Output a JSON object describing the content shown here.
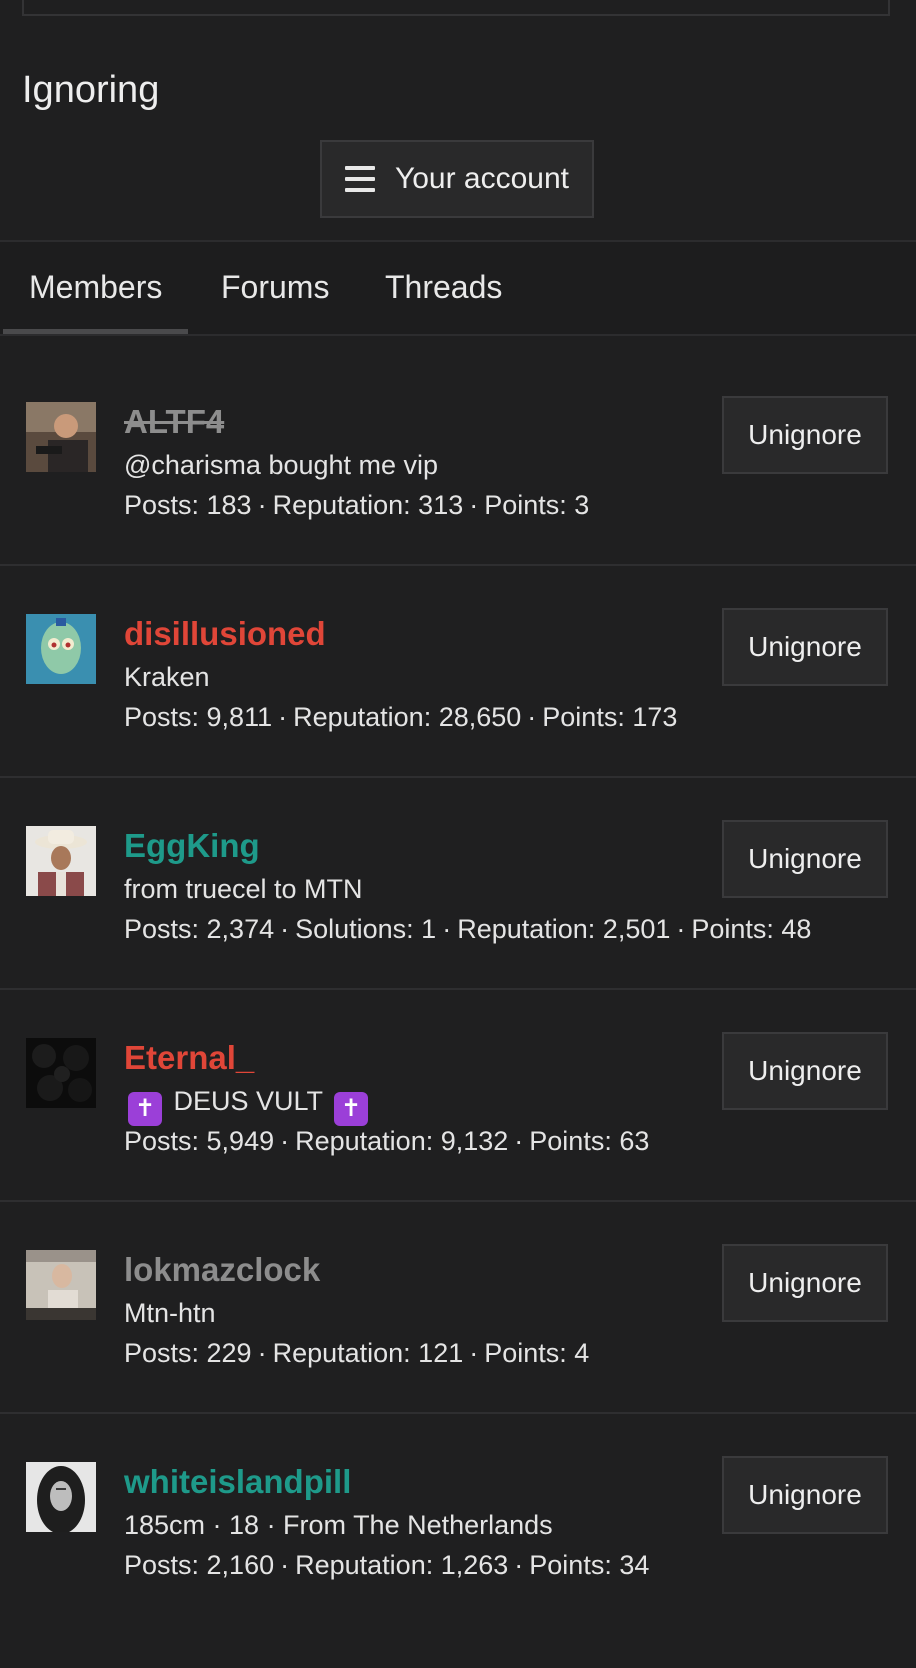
{
  "page": {
    "title": "Ignoring"
  },
  "account_menu": {
    "label": "Your account",
    "icon": "hamburger-menu-icon"
  },
  "tabs": [
    {
      "label": "Members",
      "active": true
    },
    {
      "label": "Forums",
      "active": false
    },
    {
      "label": "Threads",
      "active": false
    }
  ],
  "colors": {
    "background": "#1f1f20",
    "button_bg": "#29292a",
    "name_red": "#e04638",
    "name_teal": "#1e9a8a",
    "name_gray": "#8d8d8d",
    "cross_purple": "#9b3fd8"
  },
  "unignore_label": "Unignore",
  "stat_separator": "·",
  "members": [
    {
      "name": "ALTF4",
      "name_color": "#8d8d8d",
      "name_style": "strikethrough",
      "title": "@charisma bought me vip",
      "stats": [
        "Posts: 183",
        "Reputation: 313",
        "Points: 3"
      ]
    },
    {
      "name": "disillusioned",
      "name_color": "#e04638",
      "title": "Kraken",
      "stats": [
        "Posts: 9,811",
        "Reputation: 28,650",
        "Points: 173"
      ]
    },
    {
      "name": "EggKing",
      "name_color": "#1e9a8a",
      "title": "from truecel to MTN",
      "stats": [
        "Posts: 2,374",
        "Solutions: 1",
        "Reputation: 2,501",
        "Points: 48"
      ]
    },
    {
      "name": "Eternal_",
      "name_color": "#e04638",
      "title": "DEUS VULT",
      "title_icon": "latin-cross-icon",
      "stats": [
        "Posts: 5,949",
        "Reputation: 9,132",
        "Points: 63"
      ]
    },
    {
      "name": "lokmazclock",
      "name_color": "#8d8d8d",
      "title": "Mtn-htn",
      "stats": [
        "Posts: 229",
        "Reputation: 121",
        "Points: 4"
      ]
    },
    {
      "name": "whiteislandpill",
      "name_color": "#1e9a8a",
      "title": "185cm · 18 · From The Netherlands",
      "stats": [
        "Posts: 2,160",
        "Reputation: 1,263",
        "Points: 34"
      ]
    }
  ]
}
